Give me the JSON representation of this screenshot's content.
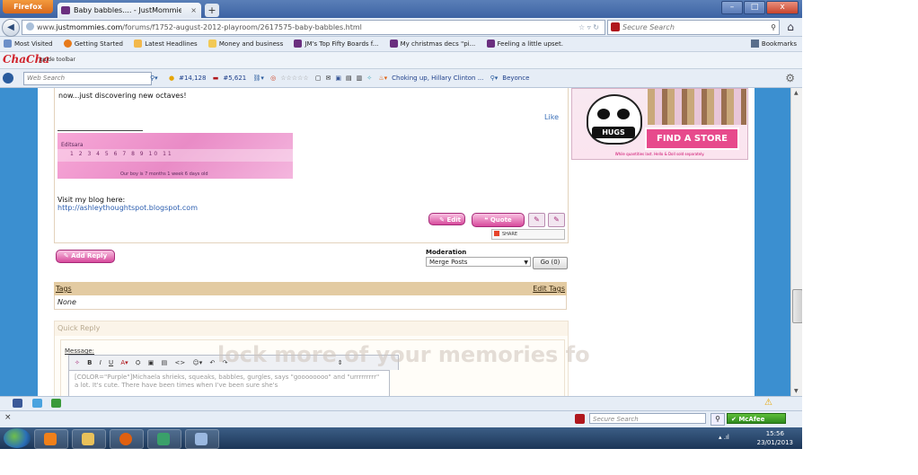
{
  "browser": {
    "firefox_label": "Firefox",
    "tab_title": "Baby babbles.... - JustMommies Messag...",
    "tab_close": "×",
    "new_tab": "+",
    "url_prefix": "www.",
    "url_domain": "justmommies.com",
    "url_path": "/forums/f1752-august-2012-playroom/2617575-baby-babbles.html",
    "search_placeholder": "Secure Search",
    "win_min": "–",
    "win_max": "□",
    "win_close": "x"
  },
  "bookmarks_bar": {
    "items": [
      "Most Visited",
      "Getting Started",
      "Latest Headlines",
      "Money and business",
      "JM's Top Fifty Boards f...",
      "My christmas decs \"pi...",
      "Feeling a little upset."
    ],
    "right": "Bookmarks"
  },
  "chacha": {
    "logo": "ChaCha",
    "sub": "guide toolbar"
  },
  "toolbar": {
    "web_search": "Web Search",
    "rank1": "#14,128",
    "rank2": "#5,621",
    "stars": "☆☆☆☆☆",
    "news": "Choking up, Hillary Clinton ...",
    "beyonce": "Beyonce"
  },
  "post": {
    "text": "now...just discovering new octaves!",
    "like": "Like",
    "sig_label": "Editsara",
    "sig_numbers": "1  2  3  4  5  6  7  8  9  10  11",
    "sig_caption": "Our boy is 7 months 1 week 6 days old",
    "blog_text": "Visit my blog here:",
    "blog_link": "http://ashleythoughtspot.blogspot.com",
    "edit": "Edit",
    "quote": "Quote",
    "share": "SHARE"
  },
  "reply": {
    "add_reply": "Add Reply",
    "moderation_label": "Moderation",
    "moderation_value": "Merge Posts",
    "go": "Go (0)"
  },
  "tags": {
    "header": "Tags",
    "edit": "Edit Tags",
    "value": "None"
  },
  "quick_reply": {
    "title": "Quick Reply",
    "message_label": "Message:",
    "editor_text": "[COLOR=\"Purple\"]Michaela shrieks, squeaks, babbles, gurgles, says \"goooooooo\" and \"urrrrrrrrr\" a lot. It's cute. There have been times when I've been sure she's"
  },
  "watermark": "lock more of your memories fo",
  "ad": {
    "hugs": "HUGS",
    "find_store": "FIND A STORE",
    "fine": "While quantities last. Hello & Doll sold separately."
  },
  "statusbar": {
    "close": "×",
    "secure_search": "Secure Search",
    "mcafee": "McAfee"
  },
  "taskbar": {
    "time": "15:56",
    "date": "23/01/2013"
  }
}
